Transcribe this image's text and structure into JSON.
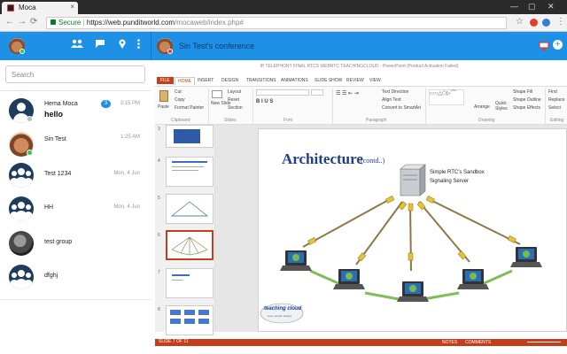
{
  "browser": {
    "tab_title": "Moca",
    "tab_close": "×",
    "secure_label": "Secure",
    "url_host": "https://web.punditworld.com",
    "url_path": "/mocaweb/index.php#",
    "back": "←",
    "forward": "→",
    "reload": "⟳",
    "star": "☆",
    "menu": "⋮",
    "min": "—",
    "max": "▢",
    "close": "✕"
  },
  "header": {
    "conference_title": "Sin Test's conference",
    "icons": [
      "group-icon",
      "chat-icon",
      "location-icon",
      "more-icon"
    ]
  },
  "sidebar": {
    "search_placeholder": "Search",
    "chats": [
      {
        "name": "Hema Moca",
        "preview": "hello",
        "time": "3:15 PM",
        "badge": "3",
        "avatar": "default",
        "status": "offline"
      },
      {
        "name": "Sin Test",
        "preview": "",
        "time": "1:25 AM",
        "badge": "",
        "avatar": "dog",
        "status": "online"
      },
      {
        "name": "Test 1234",
        "preview": "",
        "time": "Mon, 4 Jun",
        "badge": "",
        "avatar": "group",
        "status": ""
      },
      {
        "name": "HH",
        "preview": "",
        "time": "Mon, 4 Jun",
        "badge": "",
        "avatar": "group",
        "status": ""
      },
      {
        "name": "test group",
        "preview": "",
        "time": "",
        "badge": "",
        "avatar": "photo",
        "status": ""
      },
      {
        "name": "dfghj",
        "preview": "",
        "time": "",
        "badge": "",
        "avatar": "group",
        "status": ""
      }
    ]
  },
  "powerpoint": {
    "window_title": "IP TELEPHONY FINAL RTCS WEBRTC TEACHINGCLOUD - PowerPoint (Product Activation Failed)",
    "tabs": [
      "FILE",
      "HOME",
      "INSERT",
      "DESIGN",
      "TRANSITIONS",
      "ANIMATIONS",
      "SLIDE SHOW",
      "REVIEW",
      "VIEW"
    ],
    "ribbon": {
      "paste": "Paste",
      "cut": "Cut",
      "copy": "Copy",
      "format_painter": "Format Painter",
      "clipboard": "Clipboard",
      "new_slide": "New Slide",
      "layout": "Layout",
      "reset": "Reset",
      "section": "Section",
      "slides": "Slides",
      "font": "Font",
      "paragraph": "Paragraph",
      "text_direction": "Text Direction",
      "align_text": "Align Text",
      "convert_smartart": "Convert to SmartArt",
      "arrange": "Arrange",
      "quick_styles": "Quick Styles",
      "shape_fill": "Shape Fill",
      "shape_outline": "Shape Outline",
      "shape_effects": "Shape Effects",
      "drawing": "Drawing",
      "find": "Find",
      "replace": "Replace",
      "select": "Select",
      "editing": "Editing"
    },
    "slide_numbers": [
      "3",
      "4",
      "5",
      "6",
      "7",
      "8"
    ],
    "slide": {
      "title": "Architecture",
      "title_suffix": "(contd..)",
      "server_label_1": "Simple RTC's Sandbox",
      "server_label_2": "Signaling Server",
      "logo_text": "teaching cloud",
      "logo_tagline": "learn. at last, always"
    },
    "status": {
      "slide_indicator": "SLIDE 7 OF 11",
      "notes": "NOTES",
      "comments": "COMMENTS"
    }
  },
  "colors": {
    "brand_blue": "#1e90e6",
    "ppt_red": "#c43e1c",
    "online_green": "#2ecc40"
  }
}
